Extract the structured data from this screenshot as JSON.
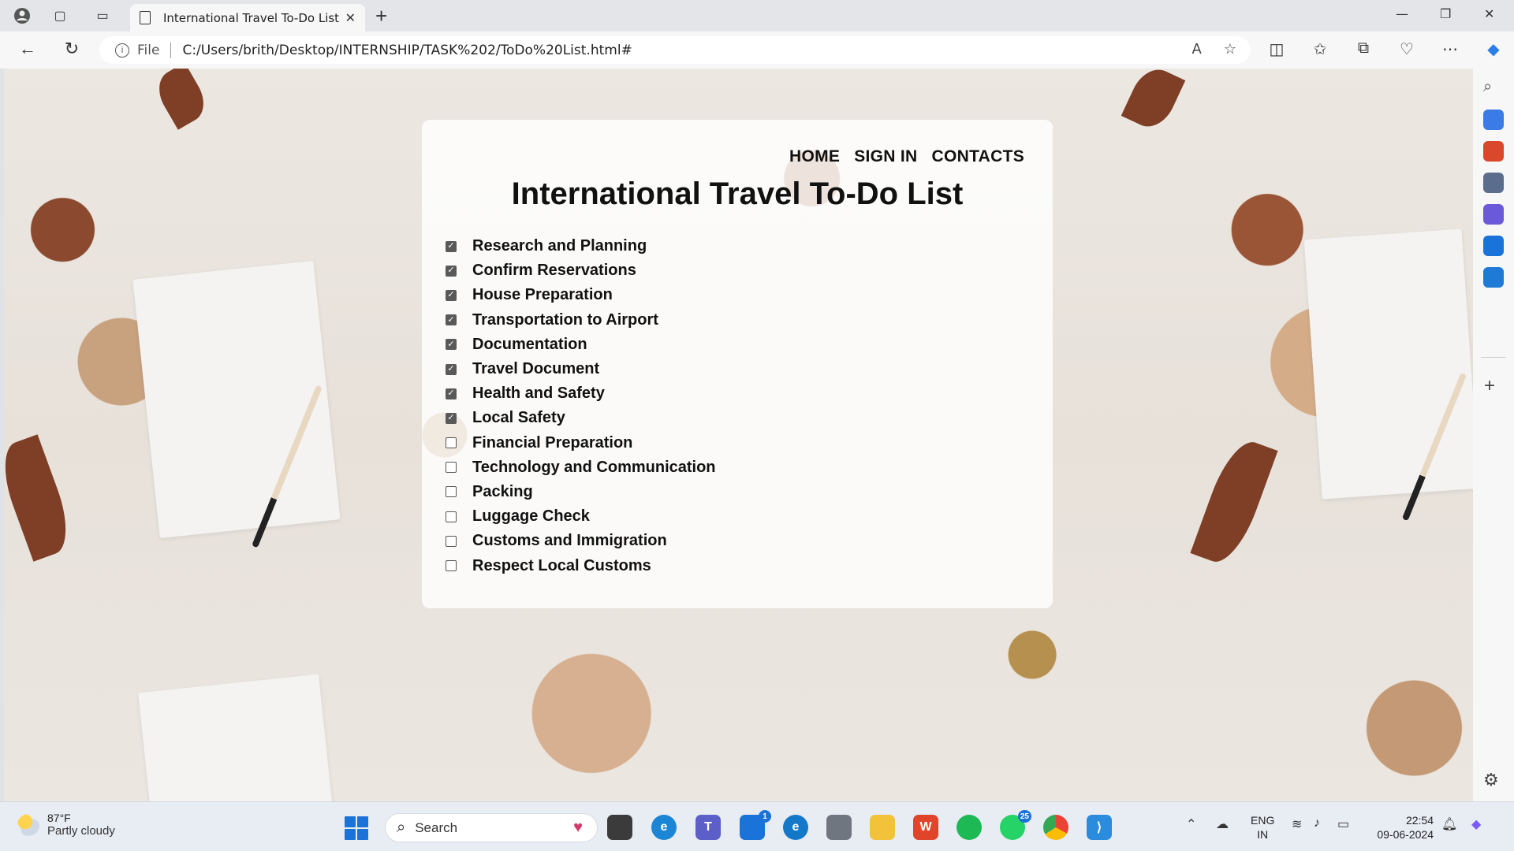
{
  "browser": {
    "tab_title": "International Travel To-Do List",
    "address_scheme_label": "File",
    "address_url": "C:/Users/brith/Desktop/INTERNSHIP/TASK%202/ToDo%20List.html#"
  },
  "page": {
    "nav": [
      "HOME",
      "SIGN IN",
      "CONTACTS"
    ],
    "title": "International Travel To-Do List",
    "todos": [
      {
        "label": "Research and Planning",
        "checked": true
      },
      {
        "label": "Confirm Reservations",
        "checked": true
      },
      {
        "label": "House Preparation",
        "checked": true
      },
      {
        "label": "Transportation to Airport",
        "checked": true
      },
      {
        "label": "Documentation",
        "checked": true
      },
      {
        "label": "Travel Document",
        "checked": true
      },
      {
        "label": "Health and Safety",
        "checked": true
      },
      {
        "label": "Local Safety",
        "checked": true
      },
      {
        "label": "Financial Preparation",
        "checked": false
      },
      {
        "label": "Technology and Communication",
        "checked": false
      },
      {
        "label": "Packing",
        "checked": false
      },
      {
        "label": "Luggage Check",
        "checked": false
      },
      {
        "label": "Customs and Immigration",
        "checked": false
      },
      {
        "label": "Respect Local Customs",
        "checked": false
      }
    ]
  },
  "taskbar": {
    "weather_temp": "87°F",
    "weather_desc": "Partly cloudy",
    "search_placeholder": "Search",
    "teams_badge": "1",
    "whatsapp_badge": "25",
    "lang_line1": "ENG",
    "lang_line2": "IN",
    "time": "22:54",
    "date": "09-06-2024"
  },
  "colors": {
    "accent": "#1a73d9",
    "checkbox_checked": "#595959",
    "card_background": "#ffffffd1"
  }
}
